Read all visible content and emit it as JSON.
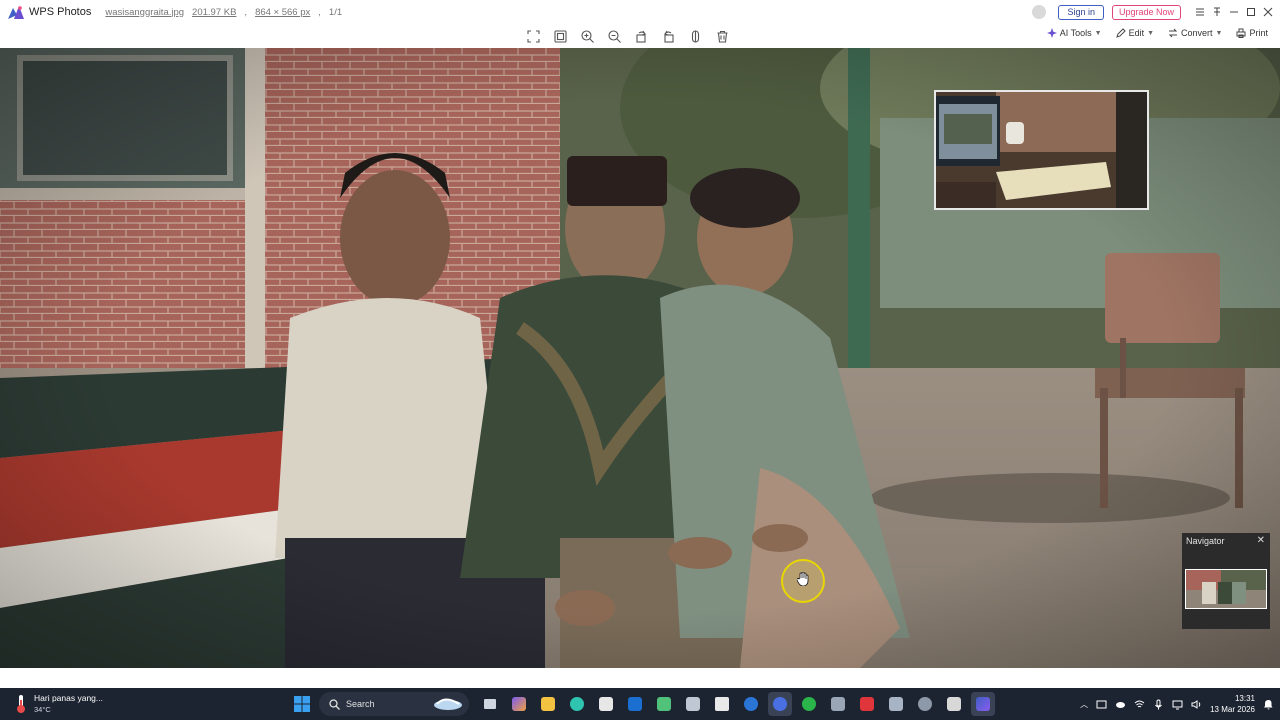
{
  "app": {
    "name": "WPS Photos",
    "file_name": "wasisanggraita.jpg",
    "file_size": "201.97 KB",
    "dimensions": "864 × 566 px",
    "page_index": "1/1"
  },
  "titlebar": {
    "sign_in_label": "Sign in",
    "upgrade_label": "Upgrade Now"
  },
  "toolbar": {
    "ai_tools_label": "AI Tools",
    "edit_label": "Edit",
    "convert_label": "Convert",
    "print_label": "Print"
  },
  "navigator": {
    "title": "Navigator"
  },
  "taskbar": {
    "weather_text": "Hari panas yang...",
    "weather_temp": "34°C",
    "search_label": "Search",
    "time": "13:31",
    "date": "13 Mar 2026"
  },
  "colors": {
    "accent": "#3f5fc4",
    "upgrade": "#e0457a",
    "taskbar_bg": "#1d2431",
    "cursor_highlight": "#e8d600"
  }
}
